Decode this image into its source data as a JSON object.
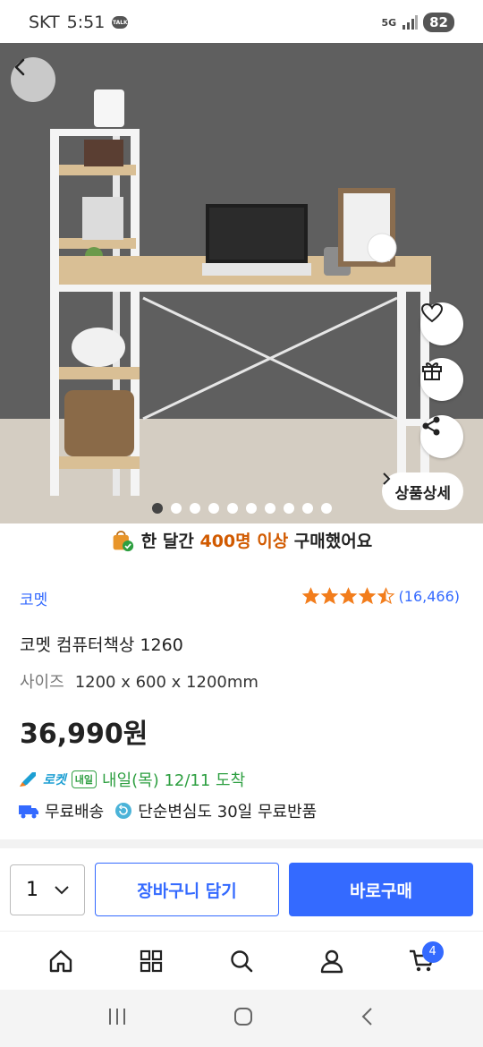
{
  "status_bar": {
    "carrier": "SKT",
    "time": "5:51",
    "talk": "TALK",
    "network": "5G",
    "battery": "82"
  },
  "hero": {
    "image_count": 10,
    "active_index": 0,
    "detail_label": "상품상세"
  },
  "promo": {
    "prefix": "한 달간 ",
    "highlight": "400명 이상",
    "suffix": " 구매했어요"
  },
  "product": {
    "brand": "코멧",
    "rating_count": "(16,466)",
    "rating": 4.5,
    "title": "코멧 컴퓨터책상 1260",
    "size_label": "사이즈",
    "size_value": "1200 x 600 x 1200mm",
    "price": "36,990원"
  },
  "delivery": {
    "rocket_label": "로켓",
    "badge": "내일",
    "arrival": "내일(목) 12/11 도착",
    "free_shipping": "무료배송",
    "return_policy": "단순변심도 30일 무료반품"
  },
  "buy_bar": {
    "quantity": "1",
    "cart_label": "장바구니 담기",
    "buy_label": "바로구매"
  },
  "bottom_nav": {
    "cart_count": "4"
  },
  "colors": {
    "accent": "#346aff",
    "rocket_green": "#2e9f41",
    "promo_orange": "#d15a00",
    "star": "#f27d1c"
  },
  "icons": [
    "back-icon",
    "heart-icon",
    "gift-icon",
    "share-icon",
    "chevron-right-icon",
    "shopping-bag-icon",
    "star-icon",
    "rocket-icon",
    "truck-icon",
    "return-icon",
    "chevron-down-icon",
    "home-icon",
    "category-icon",
    "search-icon",
    "user-icon",
    "cart-icon",
    "recent-apps-icon",
    "home-circle-icon",
    "system-back-icon"
  ]
}
